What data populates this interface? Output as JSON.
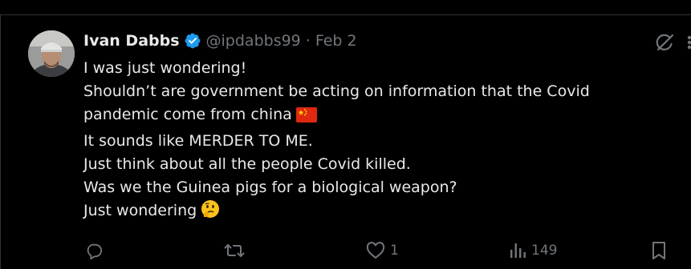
{
  "tweet": {
    "author_name": "Ivan Dabbs",
    "handle": "@ipdabbs99",
    "separator": "·",
    "date": "Feb 2",
    "lines": [
      "I was just wondering!",
      "Shouldn’t are government be acting on information that the Covid",
      "pandemic come from china",
      "It sounds like MERDER TO ME.",
      "Just think about all the people Covid killed.",
      "Was we the Guinea pigs for a biological weapon?",
      "Just wondering"
    ],
    "emojis": {
      "line_3": "china-flag",
      "line_7": "thinking-face"
    }
  },
  "actions": {
    "reply_count": "",
    "retweet_count": "",
    "like_count": "1",
    "views_count": "149"
  },
  "colors": {
    "background": "#000000",
    "text": "#e7e9ea",
    "muted": "#71767b",
    "verified": "#1d9bf0",
    "border": "#2f3336"
  }
}
